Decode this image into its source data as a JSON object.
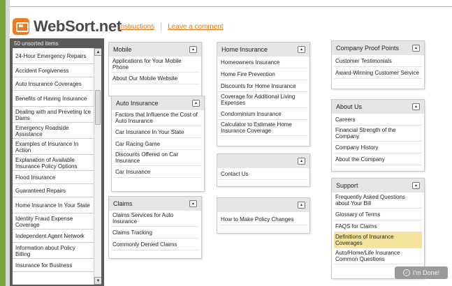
{
  "app": {
    "name": "WebSort.net"
  },
  "toplinks": {
    "instructions": "Instructions",
    "comment": "Leave a comment"
  },
  "sidebar": {
    "title": "50 unsorted items",
    "items": [
      "24-Hour Emergency Repairs",
      "Accident Forgiveness",
      "Auto Insurance Coverages",
      "Benefits of Having Insurance",
      "Dealing with and Preveting Ice Dams",
      "Emergency Roadside Assistance",
      "Examples of Insurance In Action",
      "Explanation of Available Insurance Policy Options",
      "Flood Insurance",
      "Guaranteed Repairs",
      "Home Insurance In Your State",
      "Identity Fraud Expense Coverage",
      "Independent Agent Network",
      "Information about Policy Billing",
      "Insurance for Business"
    ]
  },
  "groups": {
    "mobile": {
      "title": "Mobile",
      "items": [
        "Applications for Your Mobile Phone",
        "About Our Mobile Website"
      ]
    },
    "auto": {
      "title": "Auto Insurance",
      "items": [
        "Factors that Influence the Cost of Auto Insurance",
        "Car Insurance In Your State",
        "Car Racing Game",
        "Discounts Offered on Car Insurance",
        "Car Insurance"
      ]
    },
    "claims": {
      "title": "Claims",
      "items": [
        "Claims Services for Auto Insurance",
        "Claims Tracking",
        "Commonly Denied Claims"
      ]
    },
    "home": {
      "title": "Home Insurance",
      "items": [
        "Homeowners Insurance",
        "Home Fire Prevention",
        "Discounts for Home Insurance",
        "Coverage for Additional Living Expenses",
        "Condominium Insurance",
        "Calculator to Estimate Home Insurance Coverage"
      ]
    },
    "unnamed1": {
      "title": "",
      "items": [
        "Contact Us"
      ]
    },
    "unnamed2": {
      "title": "",
      "items": [
        "How to Make Policy Changes"
      ]
    },
    "proof": {
      "title": "Company Proof Points",
      "items": [
        "Customer Testimonials",
        "Award-Winning Customer Service"
      ]
    },
    "about": {
      "title": "About Us",
      "items": [
        "Careers",
        "Financial Strength of the Company",
        "Company History",
        "About the Company"
      ]
    },
    "support": {
      "title": "Support",
      "items": [
        "Frequently Asked Questions about Your Bill",
        "Glossary of Terms",
        "FAQS for Claims",
        "Definitions of Insurance Coverages",
        "Auto/Home/Life Insurance Common Questions"
      ]
    }
  },
  "done": {
    "label": "I'm Done!"
  },
  "colors": {
    "accent": "#e07a14",
    "highlight": "#f6e39d",
    "bar": "#7aa33a"
  }
}
